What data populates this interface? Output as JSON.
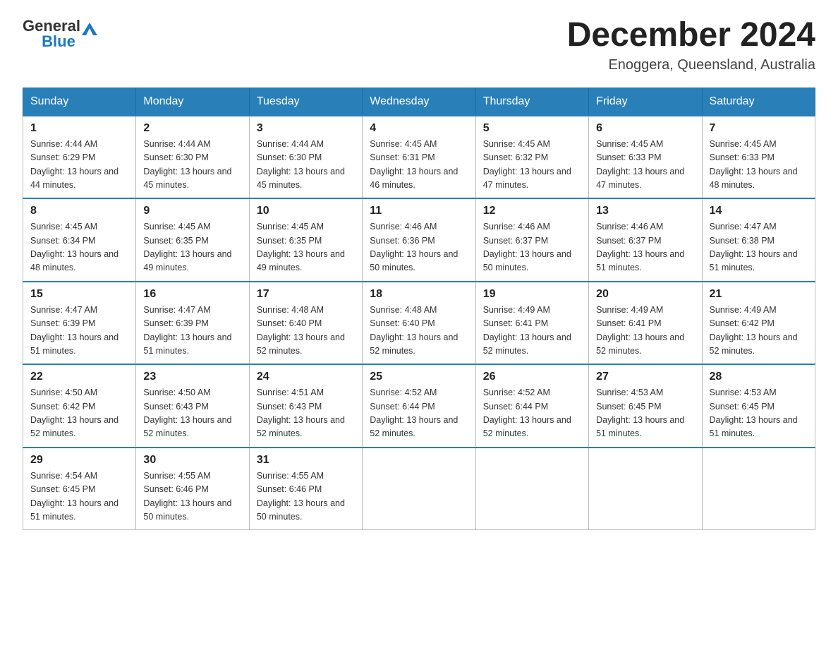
{
  "header": {
    "logo_general": "General",
    "logo_blue": "Blue",
    "month_year": "December 2024",
    "location": "Enoggera, Queensland, Australia"
  },
  "weekdays": [
    "Sunday",
    "Monday",
    "Tuesday",
    "Wednesday",
    "Thursday",
    "Friday",
    "Saturday"
  ],
  "weeks": [
    [
      {
        "day": 1,
        "sunrise": "4:44 AM",
        "sunset": "6:29 PM",
        "daylight": "13 hours and 44 minutes."
      },
      {
        "day": 2,
        "sunrise": "4:44 AM",
        "sunset": "6:30 PM",
        "daylight": "13 hours and 45 minutes."
      },
      {
        "day": 3,
        "sunrise": "4:44 AM",
        "sunset": "6:30 PM",
        "daylight": "13 hours and 45 minutes."
      },
      {
        "day": 4,
        "sunrise": "4:45 AM",
        "sunset": "6:31 PM",
        "daylight": "13 hours and 46 minutes."
      },
      {
        "day": 5,
        "sunrise": "4:45 AM",
        "sunset": "6:32 PM",
        "daylight": "13 hours and 47 minutes."
      },
      {
        "day": 6,
        "sunrise": "4:45 AM",
        "sunset": "6:33 PM",
        "daylight": "13 hours and 47 minutes."
      },
      {
        "day": 7,
        "sunrise": "4:45 AM",
        "sunset": "6:33 PM",
        "daylight": "13 hours and 48 minutes."
      }
    ],
    [
      {
        "day": 8,
        "sunrise": "4:45 AM",
        "sunset": "6:34 PM",
        "daylight": "13 hours and 48 minutes."
      },
      {
        "day": 9,
        "sunrise": "4:45 AM",
        "sunset": "6:35 PM",
        "daylight": "13 hours and 49 minutes."
      },
      {
        "day": 10,
        "sunrise": "4:45 AM",
        "sunset": "6:35 PM",
        "daylight": "13 hours and 49 minutes."
      },
      {
        "day": 11,
        "sunrise": "4:46 AM",
        "sunset": "6:36 PM",
        "daylight": "13 hours and 50 minutes."
      },
      {
        "day": 12,
        "sunrise": "4:46 AM",
        "sunset": "6:37 PM",
        "daylight": "13 hours and 50 minutes."
      },
      {
        "day": 13,
        "sunrise": "4:46 AM",
        "sunset": "6:37 PM",
        "daylight": "13 hours and 51 minutes."
      },
      {
        "day": 14,
        "sunrise": "4:47 AM",
        "sunset": "6:38 PM",
        "daylight": "13 hours and 51 minutes."
      }
    ],
    [
      {
        "day": 15,
        "sunrise": "4:47 AM",
        "sunset": "6:39 PM",
        "daylight": "13 hours and 51 minutes."
      },
      {
        "day": 16,
        "sunrise": "4:47 AM",
        "sunset": "6:39 PM",
        "daylight": "13 hours and 51 minutes."
      },
      {
        "day": 17,
        "sunrise": "4:48 AM",
        "sunset": "6:40 PM",
        "daylight": "13 hours and 52 minutes."
      },
      {
        "day": 18,
        "sunrise": "4:48 AM",
        "sunset": "6:40 PM",
        "daylight": "13 hours and 52 minutes."
      },
      {
        "day": 19,
        "sunrise": "4:49 AM",
        "sunset": "6:41 PM",
        "daylight": "13 hours and 52 minutes."
      },
      {
        "day": 20,
        "sunrise": "4:49 AM",
        "sunset": "6:41 PM",
        "daylight": "13 hours and 52 minutes."
      },
      {
        "day": 21,
        "sunrise": "4:49 AM",
        "sunset": "6:42 PM",
        "daylight": "13 hours and 52 minutes."
      }
    ],
    [
      {
        "day": 22,
        "sunrise": "4:50 AM",
        "sunset": "6:42 PM",
        "daylight": "13 hours and 52 minutes."
      },
      {
        "day": 23,
        "sunrise": "4:50 AM",
        "sunset": "6:43 PM",
        "daylight": "13 hours and 52 minutes."
      },
      {
        "day": 24,
        "sunrise": "4:51 AM",
        "sunset": "6:43 PM",
        "daylight": "13 hours and 52 minutes."
      },
      {
        "day": 25,
        "sunrise": "4:52 AM",
        "sunset": "6:44 PM",
        "daylight": "13 hours and 52 minutes."
      },
      {
        "day": 26,
        "sunrise": "4:52 AM",
        "sunset": "6:44 PM",
        "daylight": "13 hours and 52 minutes."
      },
      {
        "day": 27,
        "sunrise": "4:53 AM",
        "sunset": "6:45 PM",
        "daylight": "13 hours and 51 minutes."
      },
      {
        "day": 28,
        "sunrise": "4:53 AM",
        "sunset": "6:45 PM",
        "daylight": "13 hours and 51 minutes."
      }
    ],
    [
      {
        "day": 29,
        "sunrise": "4:54 AM",
        "sunset": "6:45 PM",
        "daylight": "13 hours and 51 minutes."
      },
      {
        "day": 30,
        "sunrise": "4:55 AM",
        "sunset": "6:46 PM",
        "daylight": "13 hours and 50 minutes."
      },
      {
        "day": 31,
        "sunrise": "4:55 AM",
        "sunset": "6:46 PM",
        "daylight": "13 hours and 50 minutes."
      },
      null,
      null,
      null,
      null
    ]
  ]
}
